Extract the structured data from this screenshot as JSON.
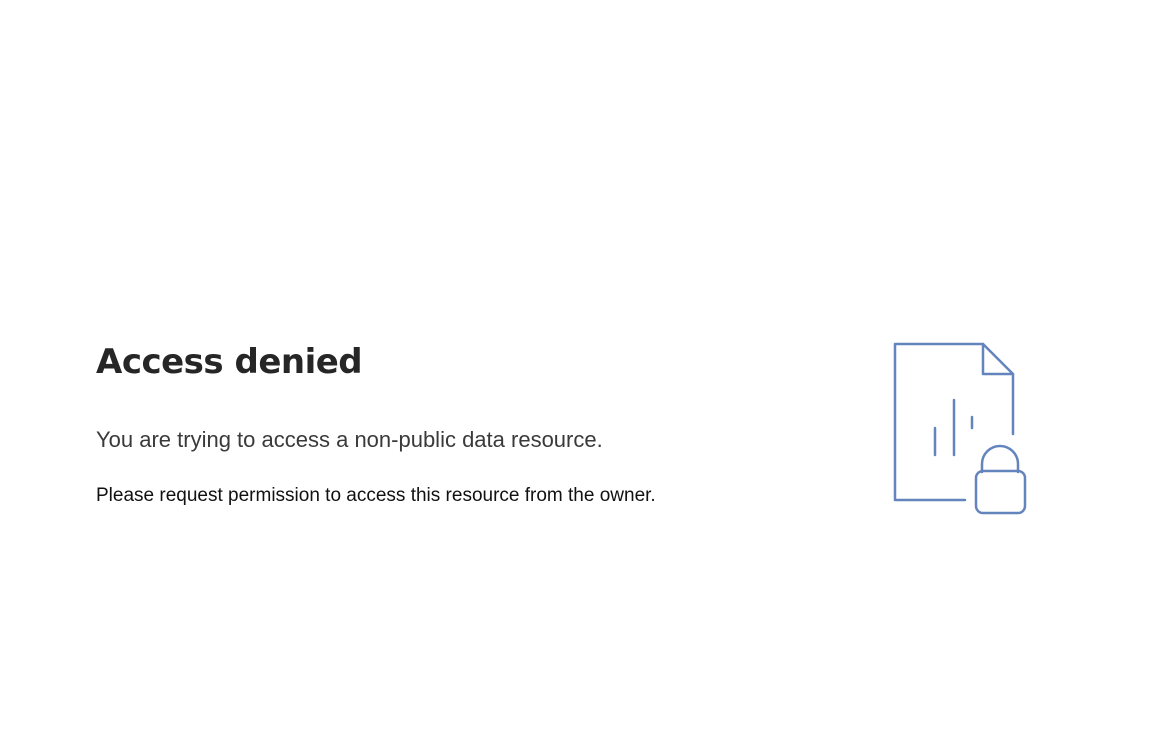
{
  "error": {
    "title": "Access denied",
    "subtitle": "You are trying to access a non-public data resource.",
    "hint": "Please request permission to access this resource from the owner."
  },
  "illustration": {
    "icon": "locked-document-icon",
    "stroke_color": "#6484bd"
  }
}
